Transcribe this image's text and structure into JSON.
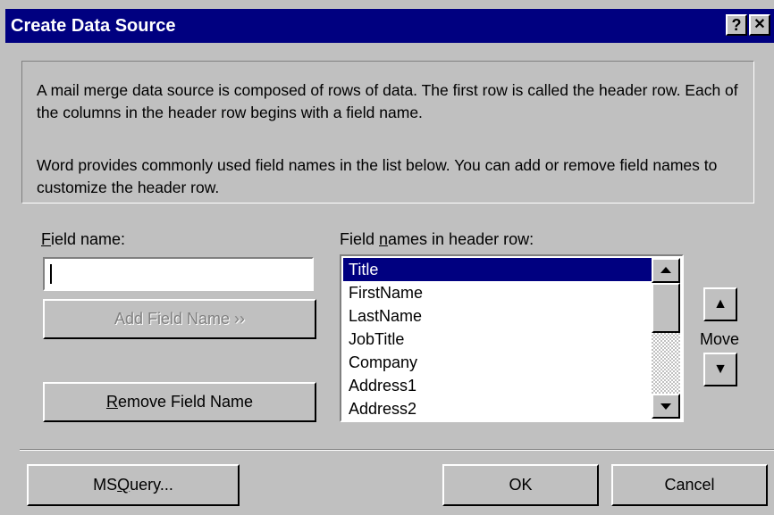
{
  "window": {
    "title": "Create Data Source",
    "help_label": "?",
    "close_label": "✕"
  },
  "description": {
    "paragraph1": "A mail merge data source is composed of rows of data. The first row is called the header row. Each of the columns in the header row begins with a field name.",
    "paragraph2": "Word provides commonly used field names in the list below. You can add or remove field names to customize the header row."
  },
  "field_name": {
    "label_access": "F",
    "label_rest": "ield name:",
    "value": ""
  },
  "header_row": {
    "label_pre": "Field ",
    "label_access": "n",
    "label_post": "ames in header row:",
    "items": [
      "Title",
      "FirstName",
      "LastName",
      "JobTitle",
      "Company",
      "Address1",
      "Address2"
    ],
    "selected": "Title"
  },
  "buttons": {
    "add_field_name": "Add Field Name  ››",
    "remove_access": "R",
    "remove_rest": "emove Field Name",
    "move_up_icon": "▲",
    "move_down_icon": "▼",
    "move_label": "Move",
    "ms_query_pre": "MS ",
    "ms_query_access": "Q",
    "ms_query_post": "uery...",
    "ok": "OK",
    "cancel": "Cancel"
  },
  "icons": {
    "scroll_up": "triangle-up",
    "scroll_down": "triangle-down",
    "move_up": "arrow-up",
    "move_down": "arrow-down"
  },
  "colors": {
    "title_bar": "#000080",
    "dialog_face": "#c0c0c0",
    "selection": "#000080"
  }
}
